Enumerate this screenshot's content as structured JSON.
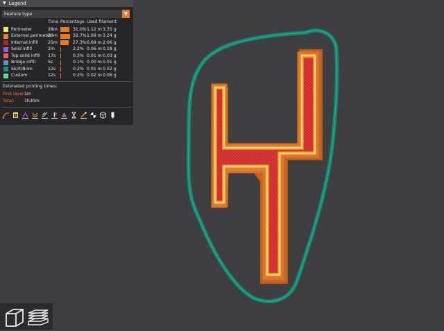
{
  "legend": {
    "title": "Legend",
    "selector_value": "Feature type",
    "columns": {
      "time": "Time",
      "percentage": "Percentage",
      "filament": "Used filament"
    },
    "rows": [
      {
        "name": "Perimeter",
        "time": "28m",
        "pct": "31.0%",
        "pct_value": 31.0,
        "length": "1.12 m",
        "weight": "3.35 g",
        "color": "#f5e663"
      },
      {
        "name": "External perimeter",
        "time": "29m",
        "pct": "32.7%",
        "pct_value": 32.7,
        "length": "1.09 m",
        "weight": "3.24 g",
        "color": "#e87f3a"
      },
      {
        "name": "Internal infill",
        "time": "25m",
        "pct": "27.3%",
        "pct_value": 27.3,
        "length": "0.69 m",
        "weight": "2.06 g",
        "color": "#b32424"
      },
      {
        "name": "Solid infill",
        "time": "2m",
        "pct": "2.2%",
        "pct_value": 2.2,
        "length": "0.06 m",
        "weight": "0.18 g",
        "color": "#9a5ad3"
      },
      {
        "name": "Top solid infill",
        "time": "17s",
        "pct": "0.3%",
        "pct_value": 0.3,
        "length": "0.01 m",
        "weight": "0.03 g",
        "color": "#f05b5b"
      },
      {
        "name": "Bridge infill",
        "time": "5s",
        "pct": "0.1%",
        "pct_value": 0.1,
        "length": "0.00 m",
        "weight": "0.01 g",
        "color": "#6d8ccf"
      },
      {
        "name": "Skirt/Brim",
        "time": "12s",
        "pct": "0.2%",
        "pct_value": 0.2,
        "length": "0.01 m",
        "weight": "0.02 g",
        "color": "#1f8f78"
      },
      {
        "name": "Custom",
        "time": "12s",
        "pct": "0.2%",
        "pct_value": 0.2,
        "length": "0.02 m",
        "weight": "0.06 g",
        "color": "#5ed9a1"
      }
    ],
    "estimated_title": "Estimated printing times:",
    "first_layer_label": "First layer:",
    "first_layer_value": "1m",
    "total_label": "Total:",
    "total_value": "1h30m"
  },
  "colors": {
    "background": "#3f3f41",
    "panel": "#262628",
    "accent": "#e57a27",
    "skirt": "#138a6f",
    "external_perimeter": "#d9722d",
    "perimeter": "#f2d55a",
    "infill": "#cf2b2b"
  },
  "toolbar_icons": [
    "travel-icon",
    "wipe-icon",
    "retractions-icon",
    "deretractions-icon",
    "seams-icon",
    "tool-changes-icon",
    "color-changes-icon",
    "pause-prints-icon",
    "custom-gcodes-icon",
    "center-of-gravity-icon",
    "shells-icon",
    "tool-marker-icon",
    "arrow-down-icon"
  ],
  "view_buttons": [
    "view-3d-icon",
    "view-layers-icon"
  ]
}
